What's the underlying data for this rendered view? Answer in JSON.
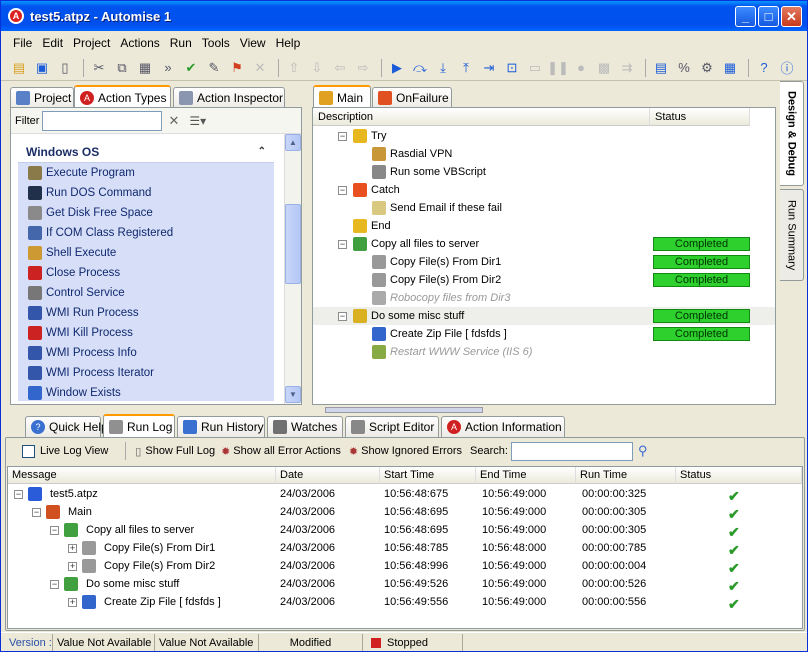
{
  "window": {
    "title": "test5.atpz - Automise 1"
  },
  "menu": [
    "File",
    "Edit",
    "Project",
    "Actions",
    "Run",
    "Tools",
    "View",
    "Help"
  ],
  "left_tabs": [
    "Project",
    "Action Types",
    "Action Inspector"
  ],
  "filter": {
    "label": "Filter",
    "value": ""
  },
  "action_group": "Windows OS",
  "actions": [
    {
      "label": "Execute Program",
      "icon": "gear-icon",
      "color": "#8a7a4a"
    },
    {
      "label": "Run DOS Command",
      "icon": "dos-icon",
      "color": "#20304a"
    },
    {
      "label": "Get Disk Free Space",
      "icon": "disk-icon",
      "color": "#8a8a8a"
    },
    {
      "label": "If COM Class Registered",
      "icon": "com-icon",
      "color": "#4466aa"
    },
    {
      "label": "Shell Execute",
      "icon": "shell-icon",
      "color": "#cc9933"
    },
    {
      "label": "Close Process",
      "icon": "close-process-icon",
      "color": "#cc2222"
    },
    {
      "label": "Control Service",
      "icon": "service-icon",
      "color": "#777777"
    },
    {
      "label": "WMI Run Process",
      "icon": "wmi-run-icon",
      "color": "#3355aa"
    },
    {
      "label": "WMI Kill Process",
      "icon": "wmi-kill-icon",
      "color": "#cc2222"
    },
    {
      "label": "WMI Process Info",
      "icon": "wmi-info-icon",
      "color": "#3355aa"
    },
    {
      "label": "WMI Process Iterator",
      "icon": "wmi-iterator-icon",
      "color": "#3355aa"
    },
    {
      "label": "Window Exists",
      "icon": "window-icon",
      "color": "#3366cc"
    }
  ],
  "design_tabs": [
    "Main",
    "OnFailure"
  ],
  "design_columns": {
    "description": "Description",
    "status": "Status"
  },
  "tree": [
    {
      "label": "Try",
      "indent": 1,
      "expander": "−",
      "icon": "try-icon",
      "icolor": "#e8b820",
      "status": "",
      "disabled": false
    },
    {
      "label": "Rasdial VPN",
      "indent": 2,
      "expander": "",
      "icon": "phone-icon",
      "icolor": "#c89838",
      "status": "",
      "disabled": false
    },
    {
      "label": "Run some VBScript",
      "indent": 2,
      "expander": "",
      "icon": "script-icon",
      "icolor": "#888888",
      "status": "",
      "disabled": false
    },
    {
      "label": "Catch",
      "indent": 1,
      "expander": "−",
      "icon": "catch-icon",
      "icolor": "#e85020",
      "status": "",
      "disabled": false
    },
    {
      "label": "Send Email if these fail",
      "indent": 2,
      "expander": "",
      "icon": "email-icon",
      "icolor": "#d8c880",
      "status": "",
      "disabled": false
    },
    {
      "label": "End",
      "indent": 1,
      "expander": "",
      "icon": "end-icon",
      "icolor": "#e8b820",
      "status": "",
      "disabled": false
    },
    {
      "label": "Copy all files to server",
      "indent": 1,
      "expander": "−",
      "icon": "group-icon",
      "icolor": "#40a040",
      "status": "Completed",
      "disabled": false
    },
    {
      "label": "Copy File(s) From Dir1",
      "indent": 2,
      "expander": "",
      "icon": "copy-icon",
      "icolor": "#999999",
      "status": "Completed",
      "disabled": false
    },
    {
      "label": "Copy File(s) From Dir2",
      "indent": 2,
      "expander": "",
      "icon": "copy-icon",
      "icolor": "#999999",
      "status": "Completed",
      "disabled": false
    },
    {
      "label": "Robocopy files from Dir3",
      "indent": 2,
      "expander": "",
      "icon": "robocopy-icon",
      "icolor": "#aaaaaa",
      "status": "",
      "disabled": true
    },
    {
      "label": "Do some misc stuff",
      "indent": 1,
      "expander": "−",
      "icon": "group-icon",
      "icolor": "#d8b020",
      "status": "Completed",
      "disabled": false
    },
    {
      "label": "Create Zip File [ fdsfds ]",
      "indent": 2,
      "expander": "",
      "icon": "zip-icon",
      "icolor": "#3366cc",
      "status": "Completed",
      "disabled": false
    },
    {
      "label": "Restart WWW Service (IIS 6)",
      "indent": 2,
      "expander": "",
      "icon": "iis-icon",
      "icolor": "#88aa44",
      "status": "",
      "disabled": true
    }
  ],
  "side_tabs": [
    "Design & Debug",
    "Run Summary"
  ],
  "bottom_tabs": [
    "Quick Help",
    "Run Log",
    "Run History",
    "Watches",
    "Script Editor",
    "Action Information"
  ],
  "log_toolbar": {
    "live": "Live Log View",
    "full": "Show Full Log",
    "errors": "Show all Error Actions",
    "ignored": "Show Ignored Errors",
    "search": "Search:",
    "search_value": ""
  },
  "log_columns": [
    "Message",
    "Date",
    "Start Time",
    "End Time",
    "Run Time",
    "Status"
  ],
  "log_rows": [
    {
      "message": "test5.atpz",
      "level": 0,
      "expander": "−",
      "icon": "play-icon",
      "date": "24/03/2006",
      "start": "10:56:48:675",
      "end": "10:56:49:000",
      "run": "00:00:00:325",
      "ok": "✔"
    },
    {
      "message": "Main",
      "level": 1,
      "expander": "−",
      "icon": "main-icon",
      "date": "24/03/2006",
      "start": "10:56:48:695",
      "end": "10:56:49:000",
      "run": "00:00:00:305",
      "ok": "✔"
    },
    {
      "message": "Copy all files to server",
      "level": 2,
      "expander": "−",
      "icon": "group-icon",
      "date": "24/03/2006",
      "start": "10:56:48:695",
      "end": "10:56:49:000",
      "run": "00:00:00:305",
      "ok": "✔"
    },
    {
      "message": "Copy File(s) From Dir1",
      "level": 3,
      "expander": "+",
      "icon": "copy-icon",
      "date": "24/03/2006",
      "start": "10:56:48:785",
      "end": "10:56:48:000",
      "run": "00:00:00:785",
      "ok": "✔"
    },
    {
      "message": "Copy File(s) From Dir2",
      "level": 3,
      "expander": "+",
      "icon": "copy-icon",
      "date": "24/03/2006",
      "start": "10:56:48:996",
      "end": "10:56:49:000",
      "run": "00:00:00:004",
      "ok": "✔"
    },
    {
      "message": "Do some misc stuff",
      "level": 2,
      "expander": "−",
      "icon": "group-icon",
      "date": "24/03/2006",
      "start": "10:56:49:526",
      "end": "10:56:49:000",
      "run": "00:00:00:526",
      "ok": "✔"
    },
    {
      "message": "Create Zip File [ fdsfds ]",
      "level": 3,
      "expander": "+",
      "icon": "zip-icon",
      "date": "24/03/2006",
      "start": "10:56:49:556",
      "end": "10:56:49:000",
      "run": "00:00:00:556",
      "ok": "✔"
    }
  ],
  "statusbar": {
    "version_label": "Version :",
    "version": "Value Not Available",
    "build": "Value Not Available",
    "modified": "Modified",
    "state": "Stopped"
  }
}
